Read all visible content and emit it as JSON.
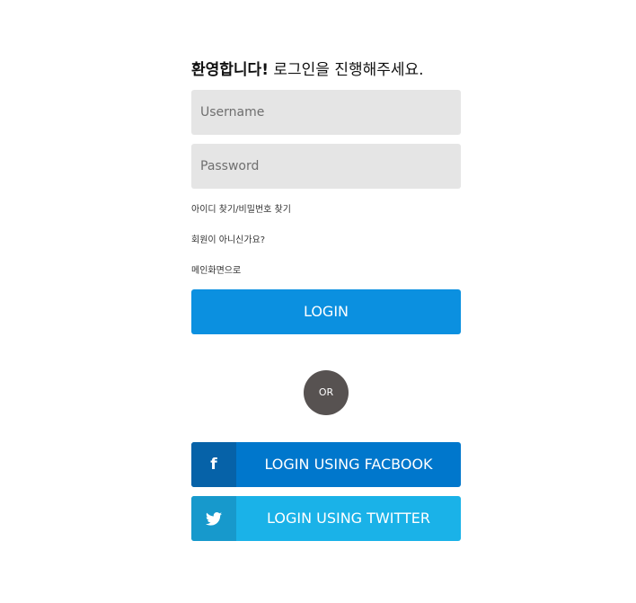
{
  "heading": {
    "bold": "환영합니다!",
    "normal": "로그인을 진행해주세요."
  },
  "username": {
    "placeholder": "Username",
    "value": ""
  },
  "password": {
    "placeholder": "Password",
    "value": ""
  },
  "links": {
    "find_account": "아이디 찾기/비밀번호 찾기",
    "signup": "회원이 아니신가요?",
    "main_page": "메인화면으로"
  },
  "login_button": "LOGIN",
  "divider": "OR",
  "social": {
    "facebook": {
      "label": "LOGIN USING FACBOOK",
      "icon": "facebook-icon",
      "glyph": "f"
    },
    "twitter": {
      "label": "LOGIN USING TWITTER",
      "icon": "twitter-icon"
    }
  },
  "colors": {
    "login": "#0b90e0",
    "divider": "#575251",
    "facebook": "#0077cc",
    "facebook_icon_bg": "#0662a8",
    "twitter": "#1ab2e8",
    "twitter_icon_bg": "#1799cc",
    "field_bg": "#e5e5e5"
  }
}
